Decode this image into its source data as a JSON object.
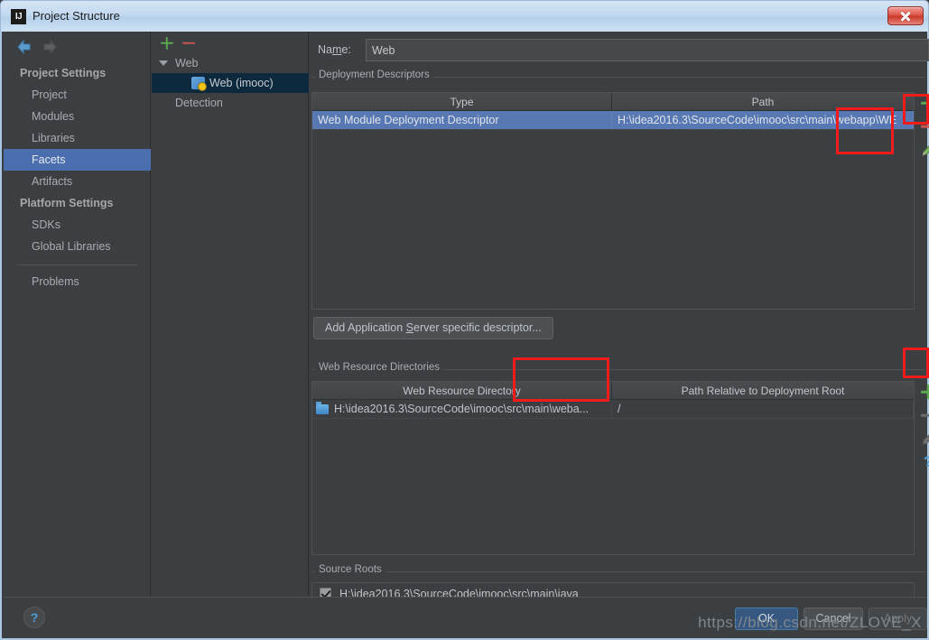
{
  "window": {
    "title": "Project Structure",
    "app_badge": "IJ",
    "close_label": "Close"
  },
  "nav_toolbar": {
    "back_icon": "arrow-left-icon",
    "forward_icon": "arrow-right-icon"
  },
  "sidebar": {
    "groups": [
      {
        "title": "Project Settings",
        "items": [
          {
            "label": "Project",
            "selected": false
          },
          {
            "label": "Modules",
            "selected": false
          },
          {
            "label": "Libraries",
            "selected": false
          },
          {
            "label": "Facets",
            "selected": true
          },
          {
            "label": "Artifacts",
            "selected": false
          }
        ]
      },
      {
        "title": "Platform Settings",
        "items": [
          {
            "label": "SDKs",
            "selected": false
          },
          {
            "label": "Global Libraries",
            "selected": false
          }
        ]
      }
    ],
    "problems_label": "Problems"
  },
  "tree": {
    "toolbar": {
      "add_label": "+",
      "remove_label": "-"
    },
    "nodes": [
      {
        "label": "Web",
        "level": 1,
        "expanded": true,
        "selected": false,
        "icon": ""
      },
      {
        "label": "Web (imooc)",
        "level": 2,
        "expanded": false,
        "selected": true,
        "icon": "web-facet-icon"
      },
      {
        "label": "Detection",
        "level": 1,
        "expanded": false,
        "selected": false,
        "icon": ""
      }
    ]
  },
  "main": {
    "name_label": "Name:",
    "name_value": "Web",
    "deployment_descriptors": {
      "group_title": "Deployment Descriptors",
      "columns": [
        "Type",
        "Path"
      ],
      "rows": [
        {
          "type": "Web Module Deployment Descriptor",
          "path": "H:\\idea2016.3\\SourceCode\\imooc\\src\\main\\webapp\\WE",
          "selected": true
        }
      ],
      "add_descriptor_button": "Add Application Server specific descriptor..."
    },
    "web_resource_directories": {
      "group_title": "Web Resource Directories",
      "columns": [
        "Web Resource Directory",
        "Path Relative to Deployment Root"
      ],
      "rows": [
        {
          "directory": "H:\\idea2016.3\\SourceCode\\imooc\\src\\main\\weba...",
          "relative_path": "/"
        }
      ]
    },
    "source_roots": {
      "group_title": "Source Roots",
      "rows": [
        {
          "path": "H:\\idea2016.3\\SourceCode\\imooc\\src\\main\\java",
          "checked": true
        }
      ]
    }
  },
  "side_tools": {
    "descriptors": [
      {
        "name": "add-descriptor-button",
        "icon": "plus-icon"
      },
      {
        "name": "remove-descriptor-button",
        "icon": "minus-icon"
      },
      {
        "name": "edit-descriptor-button",
        "icon": "pencil-icon"
      }
    ],
    "resources": [
      {
        "name": "add-resource-button",
        "icon": "plus-icon"
      },
      {
        "name": "remove-resource-button",
        "icon": "minus-icon"
      },
      {
        "name": "edit-resource-button",
        "icon": "pencil-icon"
      },
      {
        "name": "help-resource-button",
        "icon": "question-icon"
      }
    ]
  },
  "footer": {
    "help_label": "?",
    "ok_label": "OK",
    "cancel_label": "Cancel",
    "apply_label": "Apply"
  },
  "watermark": "https://blog.csdn.net/ZLOVE_X",
  "colors": {
    "accent_selected": "#4b6eaf",
    "table_selected": "#5878b4",
    "tree_selected": "#0d293e",
    "annotation": "#f21b1b",
    "add_green": "#5aa84f",
    "remove_red": "#c75450",
    "help_blue": "#4a9fd4"
  }
}
